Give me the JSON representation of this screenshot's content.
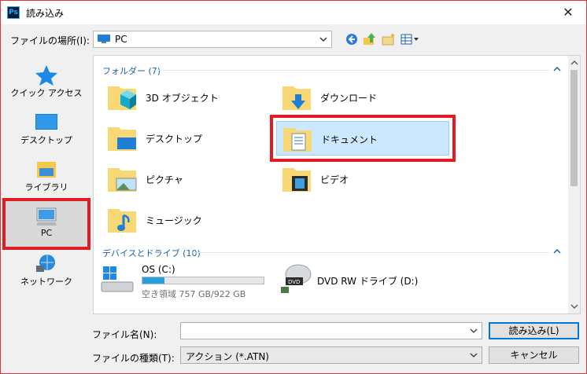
{
  "window": {
    "title": "読み込み",
    "app_icon": "Ps"
  },
  "address_bar": {
    "label": "ファイルの場所(I):",
    "value": "PC"
  },
  "sidebar": {
    "items": [
      {
        "label": "クイック アクセス",
        "icon": "star-icon"
      },
      {
        "label": "デスクトップ",
        "icon": "desktop-icon"
      },
      {
        "label": "ライブラリ",
        "icon": "library-icon"
      },
      {
        "label": "PC",
        "icon": "pc-icon",
        "selected": true
      },
      {
        "label": "ネットワーク",
        "icon": "network-icon"
      }
    ]
  },
  "content": {
    "folders_group": "フォルダー (7)",
    "folders": [
      {
        "label": "3D オブジェクト",
        "icon": "3d-objects-folder-icon"
      },
      {
        "label": "ダウンロード",
        "icon": "downloads-folder-icon"
      },
      {
        "label": "デスクトップ",
        "icon": "desktop-folder-icon"
      },
      {
        "label": "ドキュメント",
        "icon": "documents-folder-icon",
        "selected": true
      },
      {
        "label": "ピクチャ",
        "icon": "pictures-folder-icon"
      },
      {
        "label": "ビデオ",
        "icon": "videos-folder-icon"
      },
      {
        "label": "ミュージック",
        "icon": "music-folder-icon"
      }
    ],
    "devices_group": "デバイスとドライブ (10)",
    "drives": [
      {
        "label": "OS (C:)",
        "free_text": "空き領域 757 GB/922 GB",
        "used_fraction": 0.18,
        "icon": "windows-drive-icon"
      },
      {
        "label": "DVD RW ドライブ (D:)",
        "icon": "dvd-drive-icon"
      }
    ]
  },
  "footer": {
    "filename_label": "ファイル名(N):",
    "filename_value": "",
    "filetype_label": "ファイルの種類(T):",
    "filetype_value": "アクション (*.ATN)",
    "open_button": "読み込み(L)",
    "cancel_button": "キャンセル"
  },
  "colors": {
    "accent": "#0078d7",
    "highlight": "#e01b24",
    "group_text": "#1e5fa8",
    "folder": "#f8d775"
  }
}
